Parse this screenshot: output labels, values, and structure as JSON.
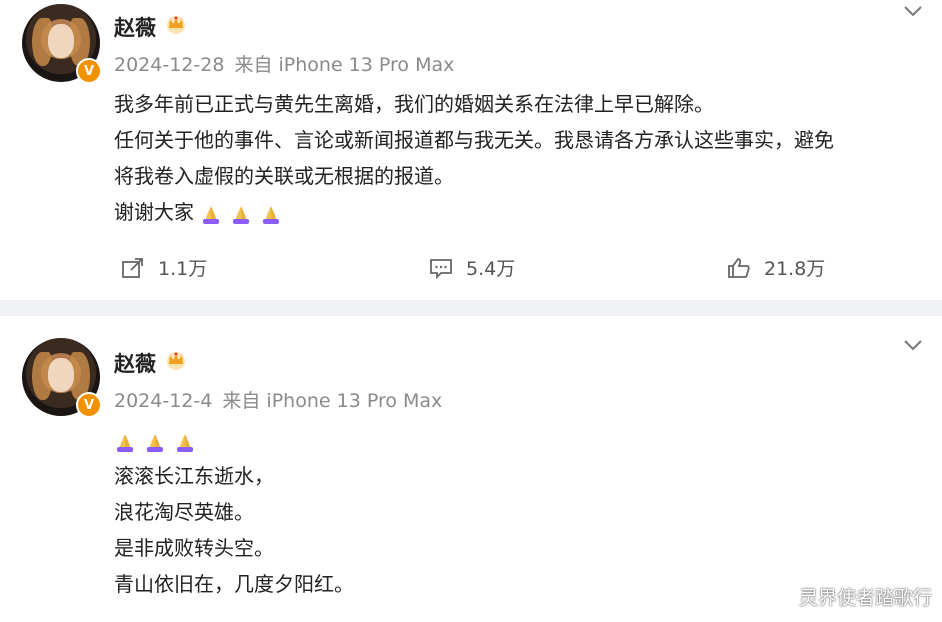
{
  "posts": [
    {
      "username": "赵薇",
      "date": "2024-12-28",
      "source": "来自 iPhone 13 Pro Max",
      "lines": [
        "我多年前已正式与黄先生离婚，我们的婚姻关系在法律上早已解除。",
        "任何关于他的事件、言论或新闻报道都与我无关。我恳请各方承认这些事实，避免",
        "将我卷入虚假的关联或无根据的报道。",
        "谢谢大家"
      ],
      "emoji_count": 3,
      "reposts": "1.1万",
      "comments": "5.4万",
      "likes": "21.8万"
    },
    {
      "username": "赵薇",
      "date": "2024-12-4",
      "source": "来自 iPhone 13 Pro Max",
      "emoji_count": 3,
      "lines": [
        "滚滚长江东逝水，",
        "浪花淘尽英雄。",
        "是非成败转头空。",
        "青山依旧在，几度夕阳红。"
      ]
    }
  ],
  "icons": {
    "verified": "V",
    "crown": "crown-icon",
    "pray": "folded-hands-icon",
    "more": "chevron-down-icon",
    "repost": "share-icon",
    "comment": "comment-icon",
    "like": "thumbs-up-icon"
  },
  "colors": {
    "badge": "#f29100",
    "meta": "#8a8a8a",
    "divider": "#f1f2f5"
  },
  "watermark": "灵界使者踏歌行"
}
